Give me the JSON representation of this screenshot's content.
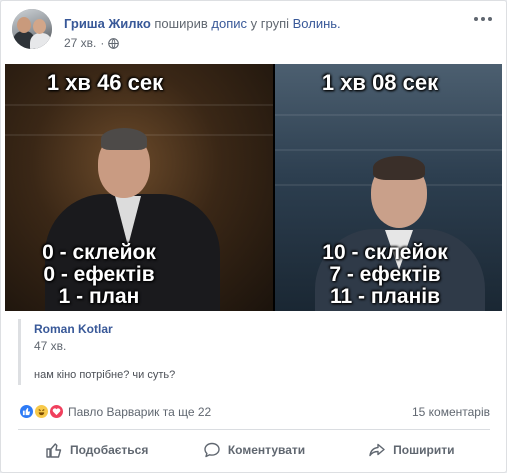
{
  "post": {
    "author": "Гриша Жилко",
    "shared_verb": "поширив",
    "shared_object": "допис",
    "group_prefix": "у групі",
    "group_name": "Волинь.",
    "time": "27 хв.",
    "privacy_icon": "globe-icon",
    "more_icon": "more-options-icon"
  },
  "image": {
    "left": {
      "time": "1 хв 46 сек",
      "stats": [
        "0 - склейок",
        "0 - ефектів",
        "1 - план"
      ]
    },
    "right": {
      "time": "1 хв 08 сек",
      "stats": [
        "10 - склейок",
        "7 - ефектів",
        "11 - планів"
      ]
    }
  },
  "shared": {
    "author": "Roman Kotlar",
    "time": "47 хв.",
    "text": "нам кіно потрібне? чи суть?"
  },
  "reactions": {
    "icons": [
      "like-icon",
      "haha-icon",
      "love-icon"
    ],
    "names": "Павло Варварик та ще 22",
    "comments": "15 коментарів"
  },
  "actions": {
    "like": "Подобається",
    "comment": "Коментувати",
    "share": "Поширити"
  },
  "colors": {
    "link": "#385898",
    "muted": "#606770",
    "like_blue": "#2e7bf6",
    "love_red": "#f0405d",
    "haha_yellow": "#f7c94a"
  }
}
